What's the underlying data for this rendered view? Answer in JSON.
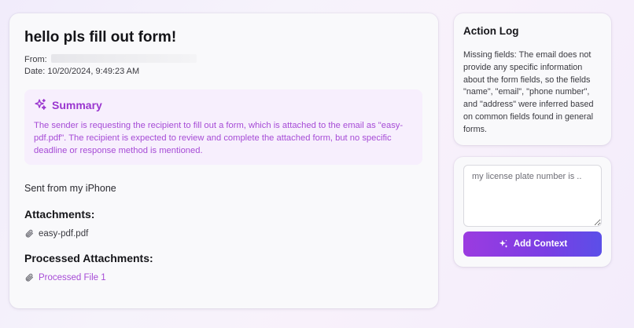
{
  "email": {
    "subject": "hello pls fill out form!",
    "from_label": "From:",
    "date_label": "Date:",
    "date_value": "10/20/2024, 9:49:23 AM",
    "summary": {
      "title": "Summary",
      "icon": "sparkle-icon",
      "text": "The sender is requesting the recipient to fill out a form, which is attached to the email as \"easy-pdf.pdf\". The recipient is expected to review and complete the attached form, but no specific deadline or response method is mentioned."
    },
    "body_text": "Sent from my iPhone",
    "attachments_heading": "Attachments:",
    "attachments": [
      "easy-pdf.pdf"
    ],
    "processed_heading": "Processed Attachments:",
    "processed": [
      "Processed File 1"
    ]
  },
  "action_log": {
    "title": "Action Log",
    "text": "Missing fields: The email does not provide any specific information about the form fields, so the fields \"name\", \"email\", \"phone number\", and \"address\" were inferred based on common fields found in general forms."
  },
  "context": {
    "placeholder": "my license plate number is ..",
    "value": "",
    "button_label": "Add Context"
  },
  "colors": {
    "accent": "#9a36cf",
    "summary_bg": "#f7effd",
    "button_start": "#9b3be0",
    "button_end": "#5b4fe8"
  }
}
